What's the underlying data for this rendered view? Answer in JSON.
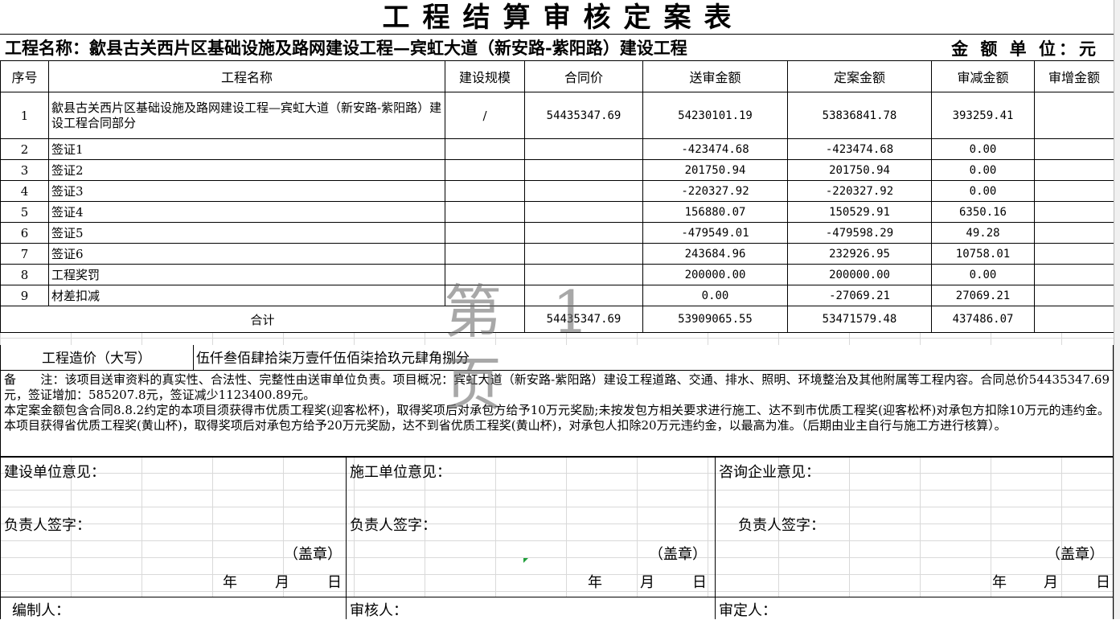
{
  "title": "工程结算审核定案表",
  "project_label": "工程名称：",
  "project_name": "歙县古关西片区基础设施及路网建设工程—宾虹大道（新安路-紫阳路）建设工程",
  "unit": "金 额 单 位：元",
  "table": {
    "headers": [
      "序号",
      "工程名称",
      "建设规模",
      "合同价",
      "送审金额",
      "定案金额",
      "审减金额",
      "审增金额"
    ],
    "rows": [
      {
        "no": "1",
        "name": "歙县古关西片区基础设施及路网建设工程—宾虹大道（新安路-紫阳路）建设工程合同部分",
        "scale": "/",
        "contract": "54435347.69",
        "submitted": "54230101.19",
        "approved": "53836841.78",
        "reduced": "393259.41",
        "increased": ""
      },
      {
        "no": "2",
        "name": "签证1",
        "scale": "",
        "contract": "",
        "submitted": "-423474.68",
        "approved": "-423474.68",
        "reduced": "0.00",
        "increased": ""
      },
      {
        "no": "3",
        "name": "签证2",
        "scale": "",
        "contract": "",
        "submitted": "201750.94",
        "approved": "201750.94",
        "reduced": "0.00",
        "increased": ""
      },
      {
        "no": "4",
        "name": "签证3",
        "scale": "",
        "contract": "",
        "submitted": "-220327.92",
        "approved": "-220327.92",
        "reduced": "0.00",
        "increased": ""
      },
      {
        "no": "5",
        "name": "签证4",
        "scale": "",
        "contract": "",
        "submitted": "156880.07",
        "approved": "150529.91",
        "reduced": "6350.16",
        "increased": ""
      },
      {
        "no": "6",
        "name": "签证5",
        "scale": "",
        "contract": "",
        "submitted": "-479549.01",
        "approved": "-479598.29",
        "reduced": "49.28",
        "increased": ""
      },
      {
        "no": "7",
        "name": "签证6",
        "scale": "",
        "contract": "",
        "submitted": "243684.96",
        "approved": "232926.95",
        "reduced": "10758.01",
        "increased": ""
      },
      {
        "no": "8",
        "name": "工程奖罚",
        "scale": "",
        "contract": "",
        "submitted": "200000.00",
        "approved": "200000.00",
        "reduced": "0.00",
        "increased": ""
      },
      {
        "no": "9",
        "name": "材差扣减",
        "scale": "",
        "contract": "",
        "submitted": "0.00",
        "approved": "-27069.21",
        "reduced": "27069.21",
        "increased": ""
      }
    ],
    "total": {
      "label": "合计",
      "contract": "54435347.69",
      "submitted": "53909065.55",
      "approved": "53471579.48",
      "reduced": "437486.07",
      "increased": ""
    }
  },
  "cost_capital": {
    "label": "工程造价（大写）",
    "value": "伍仟叁佰肆拾柒万壹仟伍佰柒拾玖元肆角捌分"
  },
  "notes": [
    "备　　注：该项目送审资料的真实性、合法性、完整性由送审单位负责。项目概况：宾虹大道（新安路-紫阳路）建设工程道路、交通、排水、照明、环境整治及其他附属等工程内容。合同总价54435347.69元，签证增加：585207.8元，签证减少1123400.89元。",
    "本定案金额包含合同8.8.2约定的本项目须获得市优质工程奖(迎客松杯)，取得奖项后对承包方给予10万元奖励;未按发包方相关要求进行施工、达不到市优质工程奖(迎客松杯)对承包方扣除10万元的违约金。本项目获得省优质工程奖(黄山杯)，取得奖项后对承包方给予20万元奖励，达不到省优质工程奖(黄山杯)，对承包人扣除20万元违约金，以最高为准。（后期由业主自行与施工方进行核算）。"
  ],
  "opinions": [
    {
      "title": "建设单位意见：",
      "sign": "负责人签字：",
      "seal": "（盖章）",
      "year": "年",
      "month": "月",
      "day": "日"
    },
    {
      "title": "施工单位意见：",
      "sign": "负责人签字：",
      "seal": "（盖章）",
      "year": "年",
      "month": "月",
      "day": "日"
    },
    {
      "title": "咨询企业意见：",
      "sign": "负责人签字：",
      "seal": "（盖章）",
      "year": "年",
      "month": "月",
      "day": "日"
    }
  ],
  "footer": {
    "compiler": "编制人：",
    "reviewer": "审核人：",
    "approver": "审定人："
  },
  "watermark": "第 1 页"
}
